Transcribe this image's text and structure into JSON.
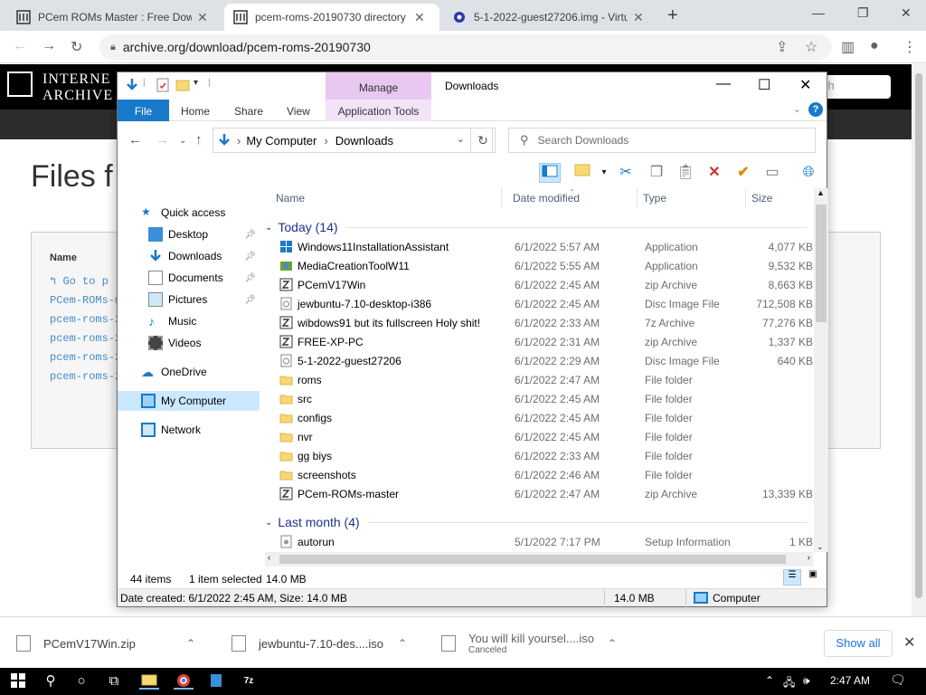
{
  "browser": {
    "tabs": [
      {
        "title": "PCem ROMs Master : Free Down"
      },
      {
        "title": "pcem-roms-20190730 directory l"
      },
      {
        "title": "5-1-2022-guest27206.img - Virtu"
      }
    ],
    "url": "archive.org/download/pcem-roms-20190730"
  },
  "archive_page": {
    "logo_line1": "INTERNE",
    "logo_line2": "ARCHIVE",
    "search_placeholder": "ch",
    "title": "Files f",
    "name_header": "Name",
    "links": [
      "Go to p",
      "PCem-ROMs-m",
      "pcem-roms-2",
      "pcem-roms-2",
      "pcem-roms-2",
      "pcem-roms-2"
    ]
  },
  "explorer": {
    "window_title": "Downloads",
    "manage_label": "Manage",
    "ribbon_tabs": {
      "file": "File",
      "home": "Home",
      "share": "Share",
      "view": "View",
      "app_tools": "Application Tools"
    },
    "address": {
      "root": "My Computer",
      "folder": "Downloads"
    },
    "search_placeholder": "Search Downloads",
    "nav_pane": {
      "quick_access": "Quick access",
      "desktop": "Desktop",
      "downloads": "Downloads",
      "documents": "Documents",
      "pictures": "Pictures",
      "music": "Music",
      "videos": "Videos",
      "onedrive": "OneDrive",
      "my_computer": "My Computer",
      "network": "Network"
    },
    "columns": {
      "name": "Name",
      "date": "Date modified",
      "type": "Type",
      "size": "Size"
    },
    "group_today": "Today (14)",
    "group_last_month": "Last month (4)",
    "files_today": [
      {
        "name": "Windows11InstallationAssistant",
        "date": "6/1/2022 5:57 AM",
        "type": "Application",
        "size": "4,077 KB",
        "icon": "windows-app-icon"
      },
      {
        "name": "MediaCreationToolW11",
        "date": "6/1/2022 5:55 AM",
        "type": "Application",
        "size": "9,532 KB",
        "icon": "installer-icon"
      },
      {
        "name": "PCemV17Win",
        "date": "6/1/2022 2:45 AM",
        "type": "zip Archive",
        "size": "8,663 KB",
        "icon": "zip-icon"
      },
      {
        "name": "jewbuntu-7.10-desktop-i386",
        "date": "6/1/2022 2:45 AM",
        "type": "Disc Image File",
        "size": "712,508 KB",
        "icon": "disc-image-icon"
      },
      {
        "name": "wibdows91 but its fullscreen Holy shit!",
        "date": "6/1/2022 2:33 AM",
        "type": "7z Archive",
        "size": "77,276 KB",
        "icon": "zip-icon"
      },
      {
        "name": "FREE-XP-PC",
        "date": "6/1/2022 2:31 AM",
        "type": "zip Archive",
        "size": "1,337 KB",
        "icon": "zip-icon"
      },
      {
        "name": "5-1-2022-guest27206",
        "date": "6/1/2022 2:29 AM",
        "type": "Disc Image File",
        "size": "640 KB",
        "icon": "disc-image-icon"
      },
      {
        "name": "roms",
        "date": "6/1/2022 2:47 AM",
        "type": "File folder",
        "size": "",
        "icon": "folder-icon"
      },
      {
        "name": "src",
        "date": "6/1/2022 2:45 AM",
        "type": "File folder",
        "size": "",
        "icon": "folder-icon"
      },
      {
        "name": "configs",
        "date": "6/1/2022 2:45 AM",
        "type": "File folder",
        "size": "",
        "icon": "folder-icon"
      },
      {
        "name": "nvr",
        "date": "6/1/2022 2:45 AM",
        "type": "File folder",
        "size": "",
        "icon": "folder-icon"
      },
      {
        "name": "gg biys",
        "date": "6/1/2022 2:33 AM",
        "type": "File folder",
        "size": "",
        "icon": "folder-icon"
      },
      {
        "name": "screenshots",
        "date": "6/1/2022 2:46 AM",
        "type": "File folder",
        "size": "",
        "icon": "folder-icon"
      },
      {
        "name": "PCem-ROMs-master",
        "date": "6/1/2022 2:47 AM",
        "type": "zip Archive",
        "size": "13,339 KB",
        "icon": "zip-icon"
      }
    ],
    "files_last_month": [
      {
        "name": "autorun",
        "date": "5/1/2022 7:17 PM",
        "type": "Setup Information",
        "size": "1 KB",
        "icon": "setup-info-icon"
      }
    ],
    "status": {
      "count": "44 items",
      "selected": "1 item selected",
      "sel_size": "14.0 MB"
    },
    "details": {
      "created": "Date created: 6/1/2022 2:45 AM, Size: 14.0 MB",
      "size": "14.0 MB",
      "location": "Computer"
    }
  },
  "downloads_shelf": {
    "items": [
      {
        "name": "PCemV17Win.zip",
        "sub": ""
      },
      {
        "name": "jewbuntu-7.10-des....iso",
        "sub": ""
      },
      {
        "name": "You will kill yoursel....iso",
        "sub": "Canceled"
      }
    ],
    "show_all": "Show all"
  },
  "taskbar": {
    "time": "2:47 AM"
  },
  "colors": {
    "accent": "#1979ca",
    "manage": "#e8c8f0",
    "selection": "#cce8ff",
    "group_text": "#1e3287"
  }
}
